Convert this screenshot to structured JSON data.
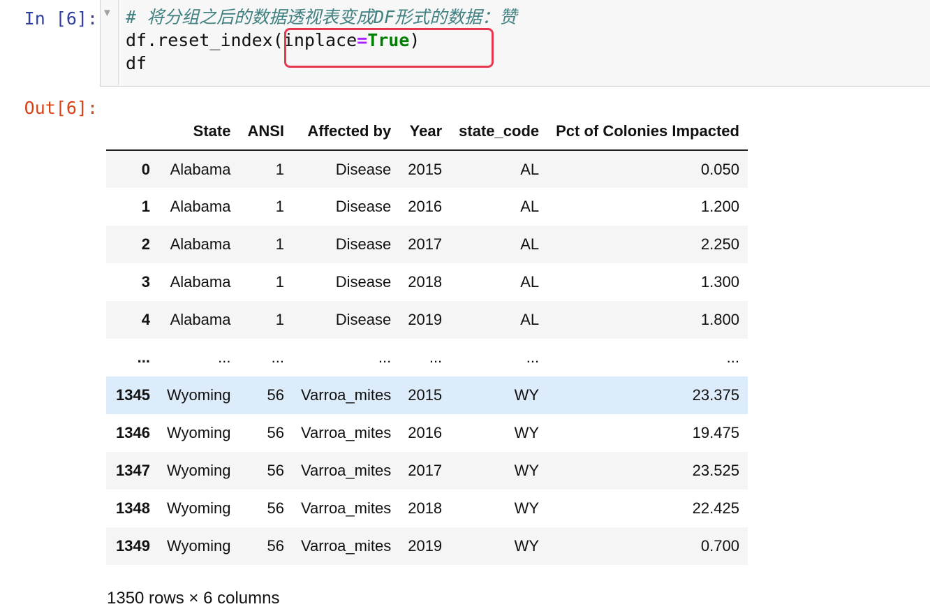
{
  "cell": {
    "in_prompt": "In [6]:",
    "out_prompt": "Out[6]:",
    "code": {
      "comment": "# 将分组之后的数据透视表变成DF形式的数据：赞",
      "line2_a": "df.reset_index(inplace",
      "line2_op": "=",
      "line2_kw": "True",
      "line2_b": ")",
      "line3": "df"
    },
    "collapse_icon": "triangle-down-icon",
    "highlight_color": "#e8384f"
  },
  "table": {
    "columns": [
      "",
      "State",
      "ANSI",
      "Affected by",
      "Year",
      "state_code",
      "Pct of Colonies Impacted"
    ],
    "rows": [
      [
        "0",
        "Alabama",
        "1",
        "Disease",
        "2015",
        "AL",
        "0.050"
      ],
      [
        "1",
        "Alabama",
        "1",
        "Disease",
        "2016",
        "AL",
        "1.200"
      ],
      [
        "2",
        "Alabama",
        "1",
        "Disease",
        "2017",
        "AL",
        "2.250"
      ],
      [
        "3",
        "Alabama",
        "1",
        "Disease",
        "2018",
        "AL",
        "1.300"
      ],
      [
        "4",
        "Alabama",
        "1",
        "Disease",
        "2019",
        "AL",
        "1.800"
      ],
      [
        "...",
        "...",
        "...",
        "...",
        "...",
        "...",
        "..."
      ],
      [
        "1345",
        "Wyoming",
        "56",
        "Varroa_mites",
        "2015",
        "WY",
        "23.375"
      ],
      [
        "1346",
        "Wyoming",
        "56",
        "Varroa_mites",
        "2016",
        "WY",
        "19.475"
      ],
      [
        "1347",
        "Wyoming",
        "56",
        "Varroa_mites",
        "2017",
        "WY",
        "23.525"
      ],
      [
        "1348",
        "Wyoming",
        "56",
        "Varroa_mites",
        "2018",
        "WY",
        "22.425"
      ],
      [
        "1349",
        "Wyoming",
        "56",
        "Varroa_mites",
        "2019",
        "WY",
        "0.700"
      ]
    ],
    "hovered_row_index": 6,
    "footer": "1350 rows × 6 columns"
  }
}
